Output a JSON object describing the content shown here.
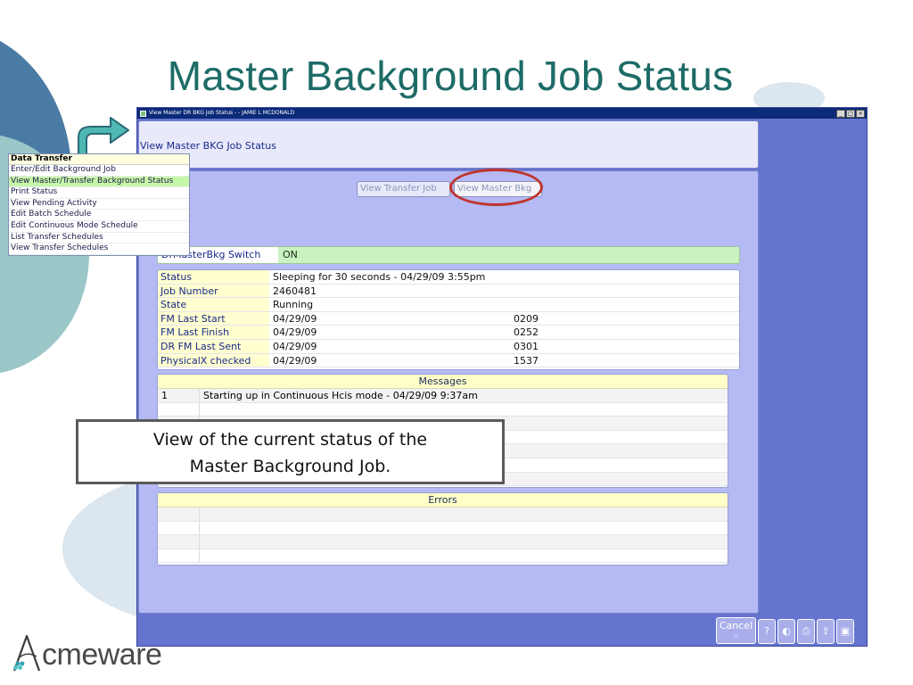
{
  "slide": {
    "title": "Master Background Job Status",
    "callout_line1": "View of the current status of the",
    "callout_line2": "Master Background Job.",
    "logo_text": "cmeware",
    "colors": {
      "title": "#1d6b67",
      "window_bg": "#6474cf",
      "highlight_oval": "#c0342c"
    }
  },
  "window": {
    "title": "View Master DR BKG Job Status - - JAMIE L MCDONALD",
    "controls": {
      "minimize": "_",
      "maximize": "□",
      "close": "×"
    },
    "page_title": "View Master BKG Job Status",
    "tabs": {
      "transfer": "View Transfer Job",
      "master": "View Master Bkg"
    },
    "switch": {
      "label": "DrMasterBkg Switch",
      "value": "ON"
    },
    "status_rows": [
      {
        "label": "Status",
        "value": "Sleeping for 30 seconds - 04/29/09 3:55pm",
        "extra": ""
      },
      {
        "label": "Job Number",
        "value": "2460481",
        "extra": ""
      },
      {
        "label": "State",
        "value": "Running",
        "extra": ""
      },
      {
        "label": "FM Last Start",
        "value": "04/29/09",
        "extra": "0209"
      },
      {
        "label": "FM Last Finish",
        "value": "04/29/09",
        "extra": "0252"
      },
      {
        "label": "DR FM Last Sent",
        "value": "04/29/09",
        "extra": "0301"
      },
      {
        "label": "PhysicalX checked",
        "value": "04/29/09",
        "extra": "1537"
      }
    ],
    "messages": {
      "header": "Messages",
      "rows": [
        {
          "num": "1",
          "text": "Starting up in Continuous Hcis mode - 04/29/09 9:37am"
        }
      ]
    },
    "errors": {
      "header": "Errors"
    },
    "cancel_label": "Cancel",
    "cancel_x": "✕",
    "icon_buttons": [
      "?",
      "◐",
      "⎙",
      "⇪",
      "▣"
    ]
  },
  "menu": {
    "header": "Data Transfer",
    "items": [
      "Enter/Edit Background Job",
      "View Master/Transfer Background Status",
      "Print Status",
      "View Pending Activity",
      "Edit Batch Schedule",
      "Edit Continuous Mode Schedule",
      "List Transfer Schedules",
      "View Transfer Schedules"
    ]
  }
}
